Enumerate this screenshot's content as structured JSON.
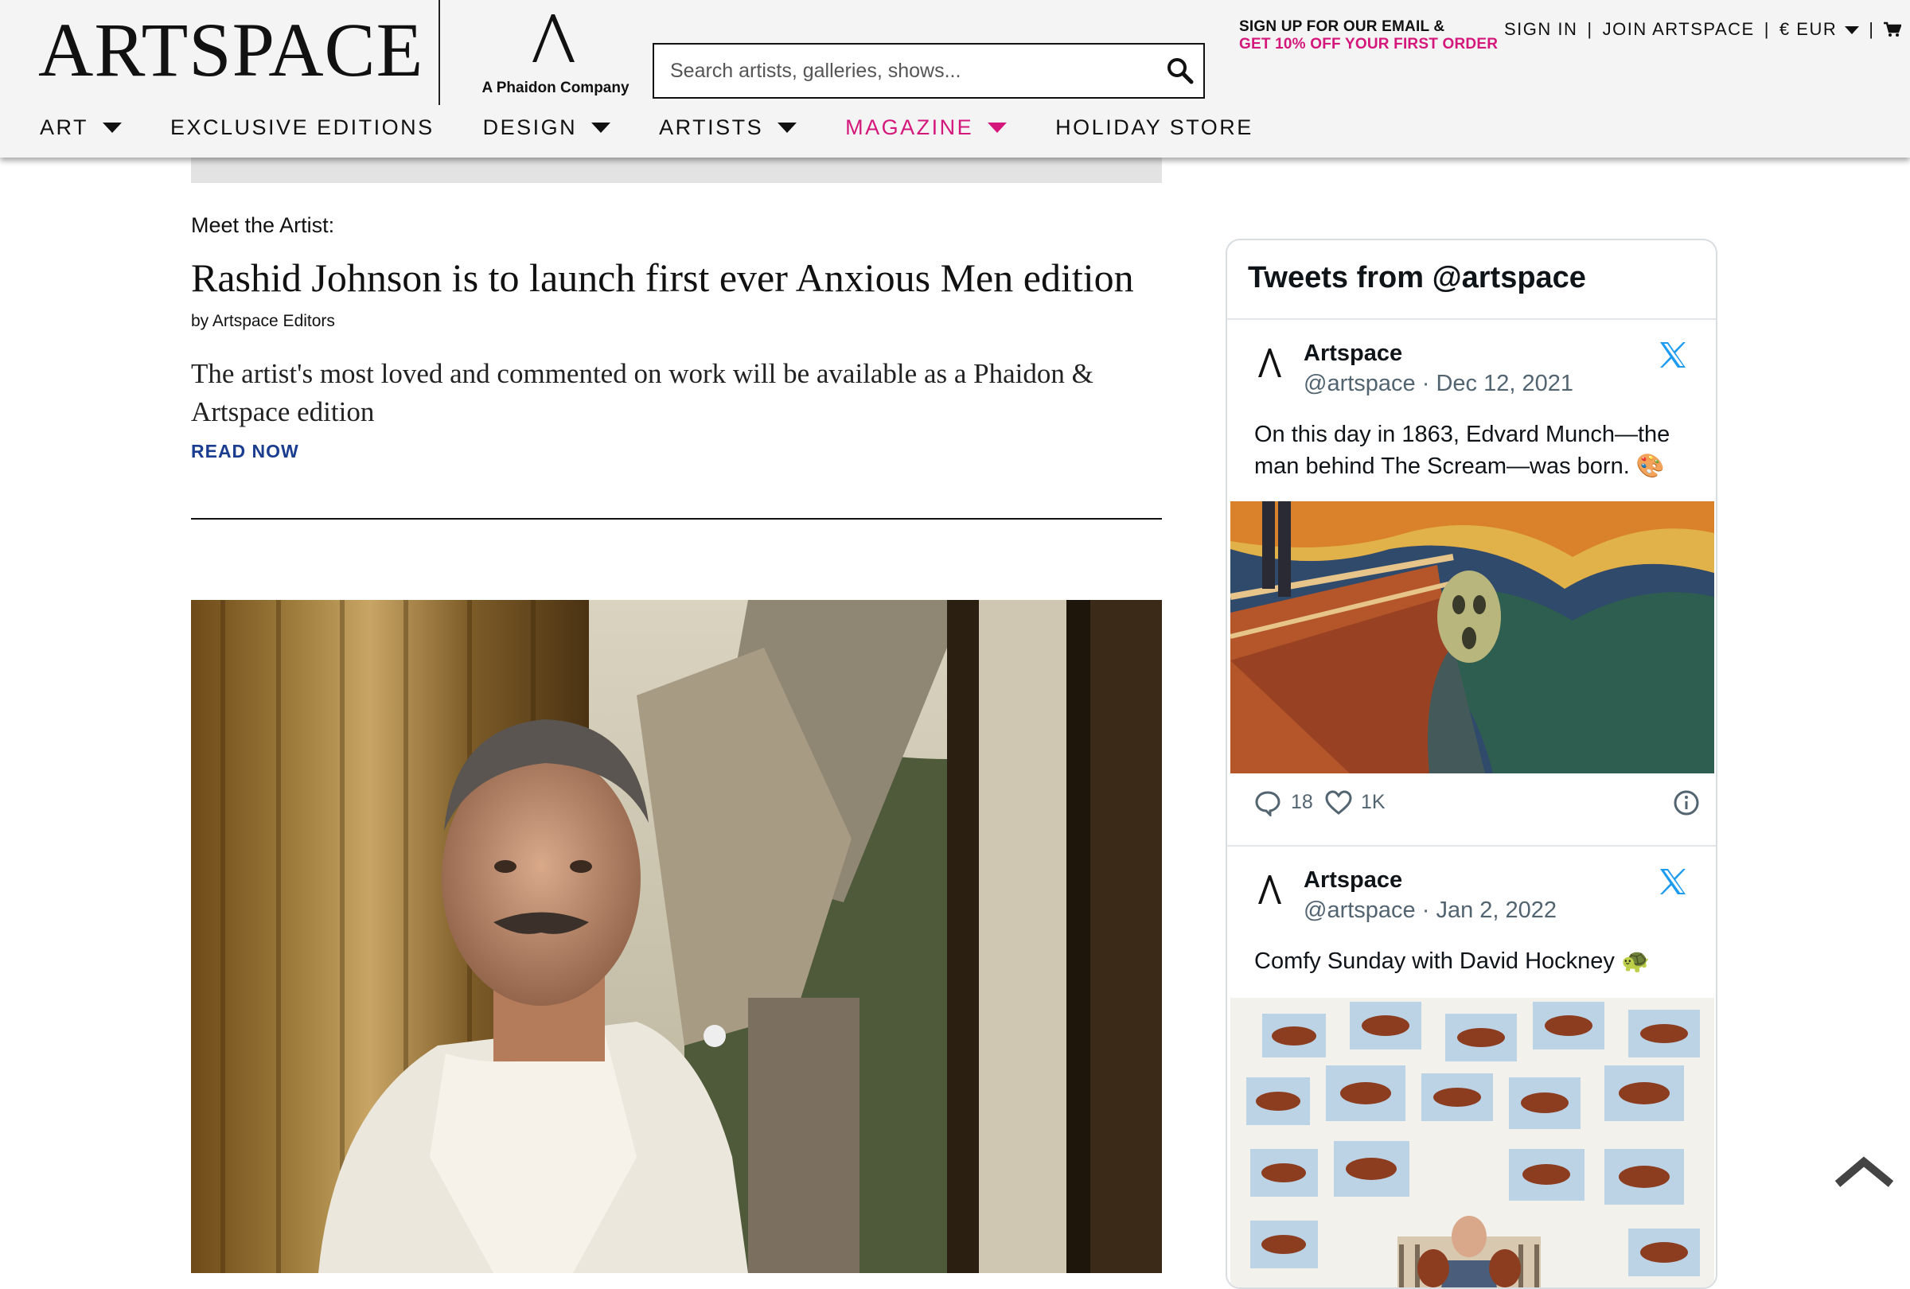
{
  "header": {
    "logo": "ARTSPACE",
    "phaidon_tagline": "A Phaidon Company",
    "search_placeholder": "Search artists, galleries, shows...",
    "promo_line1": "SIGN UP FOR OUR EMAIL &",
    "promo_line2": "GET 10% OFF YOUR FIRST ORDER",
    "sign_in": "SIGN IN",
    "join": "JOIN ARTSPACE",
    "currency": "€ EUR",
    "separator": "|",
    "colors": {
      "accent": "#d4177b",
      "link": "#1a3d8f",
      "header_bg": "#f4f4f4"
    }
  },
  "nav": [
    {
      "label": "ART",
      "has_dropdown": true
    },
    {
      "label": "EXCLUSIVE EDITIONS",
      "has_dropdown": false
    },
    {
      "label": "DESIGN",
      "has_dropdown": true
    },
    {
      "label": "ARTISTS",
      "has_dropdown": true
    },
    {
      "label": "MAGAZINE",
      "has_dropdown": true,
      "active": true
    },
    {
      "label": "HOLIDAY STORE",
      "has_dropdown": false
    }
  ],
  "article": {
    "kicker": "Meet the Artist:",
    "title": "Rashid Johnson is to launch first ever Anxious Men edition",
    "byline": "by Artspace Editors",
    "standfirst": "The artist's most loved and commented on work will be available as a Phaidon & Artspace edition",
    "cta": "READ NOW"
  },
  "tweets": {
    "title": "Tweets from @artspace",
    "items": [
      {
        "name": "Artspace",
        "handle_date": "@artspace · Dec 12, 2021",
        "text": "On this day in 1863, Edvard Munch—the man behind The Scream—was born. 🎨",
        "replies": "18",
        "likes": "1K"
      },
      {
        "name": "Artspace",
        "handle_date": "@artspace · Jan 2, 2022",
        "text": "Comfy Sunday with David Hockney 🐢"
      }
    ]
  }
}
